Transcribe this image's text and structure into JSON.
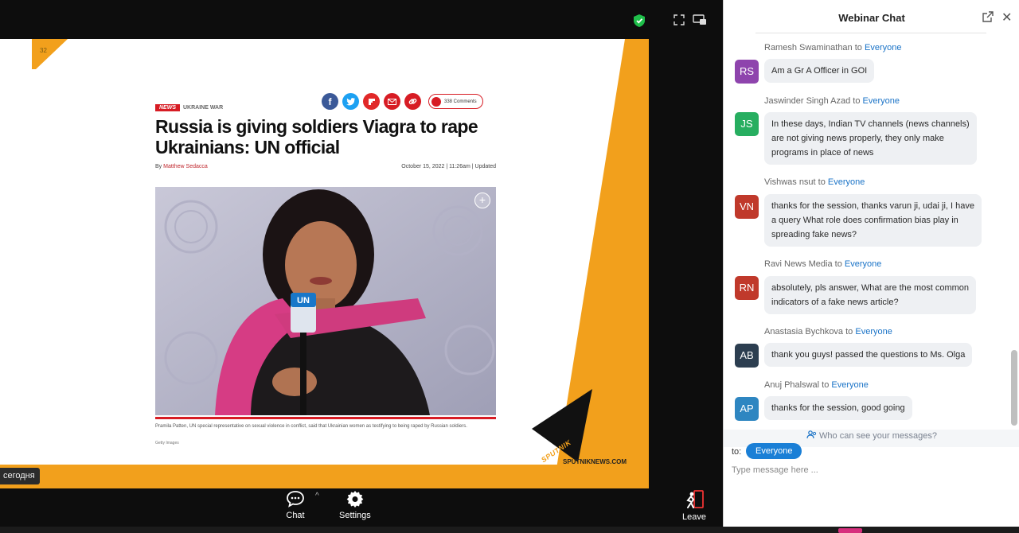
{
  "slide": {
    "corner_number": "32",
    "category_badge": "NEWS",
    "category_sub": "UKRAINE WAR",
    "comments_label": "338 Comments",
    "headline": "Russia is giving soldiers Viagra to rape Ukrainians: UN official",
    "byline_prefix": "By",
    "byline_author": "Matthew Sedacca",
    "dateline": "October 15, 2022 | 11:26am | Updated",
    "un_mic_label": "UN",
    "caption": "Pramila Patten, UN special representative on sexual violence in conflict, said that Ukrainian women as testifying to being raped by Russian soldiers.",
    "credit": "Getty Images",
    "sputnik_logo": "SPUTNIK",
    "sputnik_url": "SPUTNIKNEWS.COM",
    "share_icons": [
      "facebook-icon",
      "twitter-icon",
      "flipboard-icon",
      "email-icon",
      "link-icon"
    ]
  },
  "overlay_text": "сегодня",
  "toolbar": {
    "chat_label": "Chat",
    "settings_label": "Settings",
    "leave_label": "Leave"
  },
  "chat": {
    "title": "Webinar Chat",
    "to_word": "to",
    "messages": [
      {
        "sender": "Ramesh Swaminathan",
        "recipient": "Everyone",
        "initials": "RS",
        "color": "#8e44ad",
        "lines": [
          "Am a Gr A Officer in GOI"
        ]
      },
      {
        "sender": "Jaswinder Singh Azad",
        "recipient": "Everyone",
        "initials": "JS",
        "color": "#27ae60",
        "lines": [
          "In these days, Indian TV channels (news channels)",
          "are not giving news properly, they only make",
          "programs in place of news"
        ]
      },
      {
        "sender": "Vishwas nsut",
        "recipient": "Everyone",
        "initials": "VN",
        "color": "#c0392b",
        "lines": [
          "thanks for the session, thanks varun ji, udai ji, I have",
          "a query What role does confirmation bias play in",
          "spreading fake news?"
        ]
      },
      {
        "sender": "Ravi News Media",
        "recipient": "Everyone",
        "initials": "RN",
        "color": "#c0392b",
        "lines": [
          "absolutely, pls answer, What are the most common",
          "indicators of a fake news article?"
        ]
      },
      {
        "sender": "Anastasia Bychkova",
        "recipient": "Everyone",
        "initials": "AB",
        "color": "#2c3e50",
        "lines": [
          "thank you guys! passed the questions to Ms. Olga"
        ]
      },
      {
        "sender": "Anuj Phalswal",
        "recipient": "Everyone",
        "initials": "AP",
        "color": "#2e86c1",
        "lines": [
          "thanks for the session, good going"
        ]
      }
    ],
    "who_can_see": "Who can see your messages?",
    "to_label": "to:",
    "to_recipient": "Everyone",
    "input_placeholder": "Type message here ..."
  }
}
